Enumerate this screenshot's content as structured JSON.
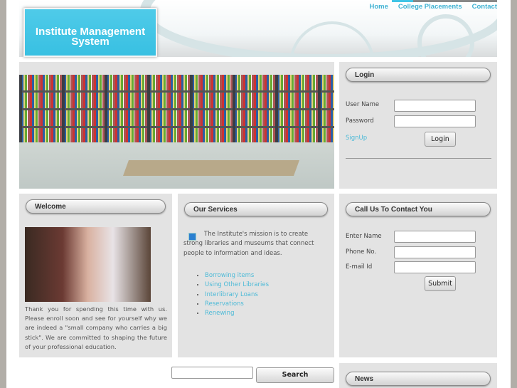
{
  "header": {
    "title": "Institute Management System",
    "nav": [
      "Home",
      "College Placements",
      "Contact"
    ]
  },
  "login": {
    "title": "Login",
    "username_label": "User Name",
    "password_label": "Password",
    "username_value": "",
    "password_value": "",
    "signup": "SignUp",
    "button": "Login"
  },
  "welcome": {
    "title": "Welcome",
    "text": "Thank you for spending this time with us. Please enroll soon and see for yourself why we are indeed a \"small company who carries a big stick\". We are committed to shaping the future of your professional education."
  },
  "services": {
    "title": "Our Services",
    "intro": "The Institute's mission is to create strong libraries and museums that connect people to information and ideas.",
    "items": [
      "Borrowing items",
      "Using Other Libraries",
      "Interlibrary Loans",
      "Reservations",
      "Renewing"
    ]
  },
  "contact": {
    "title": "Call Us To Contact You",
    "name_label": "Enter Name",
    "phone_label": "Phone No.",
    "email_label": "E-mail Id",
    "button": "Submit"
  },
  "search": {
    "value": "",
    "button": "Search"
  },
  "news": {
    "title": "News"
  }
}
